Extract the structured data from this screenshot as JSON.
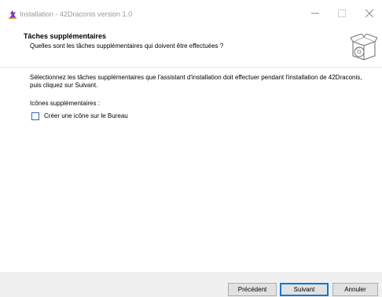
{
  "window": {
    "title": "Installation - 42Draconis version 1.0",
    "controls": {
      "minimize_icon": "minimize-icon",
      "maximize_icon": "maximize-icon",
      "close_icon": "close-icon"
    }
  },
  "header": {
    "title": "Tâches supplémentaires",
    "subtitle": "Quelles sont les tâches supplémentaires qui doivent être effectuées ?"
  },
  "content": {
    "description": "Sélectionnez les tâches supplémentaires que l'assistant d'installation doit effectuer pendant l'installation de 42Draconis, puis cliquez sur Suivant.",
    "group_label": "Icônes supplémentaires :",
    "tasks": [
      {
        "label": "Créer une icône sur le Bureau",
        "checked": false
      }
    ]
  },
  "buttons": {
    "back": "Précédent",
    "next": "Suivant",
    "cancel": "Annuler"
  },
  "colors": {
    "accent": "#0078d7",
    "footer_bg": "#f0f0f0",
    "checkbox_border": "#2f66b5"
  }
}
